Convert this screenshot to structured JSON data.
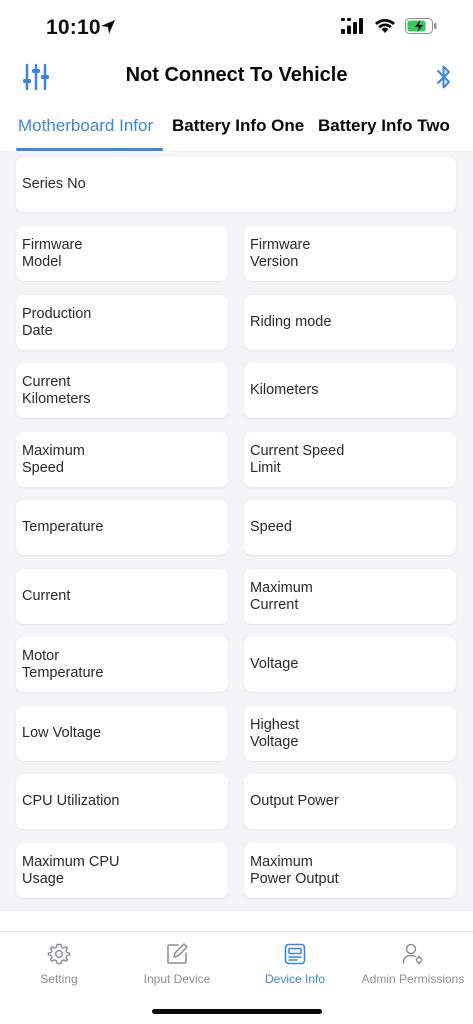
{
  "status_bar": {
    "time": "10:10",
    "battery_color": "#34c759"
  },
  "header": {
    "title": "Not Connect To Vehicle"
  },
  "tabs": [
    {
      "label": "Motherboard Infor",
      "active": true
    },
    {
      "label": "Battery Info One",
      "active": false
    },
    {
      "label": "Battery Info Two",
      "active": false
    }
  ],
  "fields": {
    "series_no": "Series No",
    "firmware_model": "Firmware\nModel",
    "firmware_version": "Firmware\nVersion",
    "production_date": "Production\nDate",
    "riding_mode": "Riding mode",
    "current_kilometers": "Current\nKilometers",
    "kilometers": "Kilometers",
    "maximum_speed": "Maximum\nSpeed",
    "current_speed_limit": "Current Speed\nLimit",
    "temperature": "Temperature",
    "speed": "Speed",
    "current": "Current",
    "maximum_current": "Maximum\nCurrent",
    "motor_temperature": "Motor\nTemperature",
    "voltage": "Voltage",
    "low_voltage": "Low Voltage",
    "highest_voltage": "Highest\nVoltage",
    "cpu_utilization": "CPU Utilization",
    "output_power": "Output Power",
    "maximum_cpu_usage": "Maximum CPU\nUsage",
    "maximum_power_output": "Maximum\nPower Output"
  },
  "tabbar": [
    {
      "label": "Setting",
      "icon": "gear-icon",
      "active": false
    },
    {
      "label": "Input Device",
      "icon": "edit-icon",
      "active": false
    },
    {
      "label": "Device Info",
      "icon": "device-info-icon",
      "active": true
    },
    {
      "label": "Admin Permissions",
      "icon": "admin-user-icon",
      "active": false
    }
  ],
  "colors": {
    "accent": "#3a86e0",
    "background": "#f4f4f6",
    "inactive": "#8e8e93"
  }
}
